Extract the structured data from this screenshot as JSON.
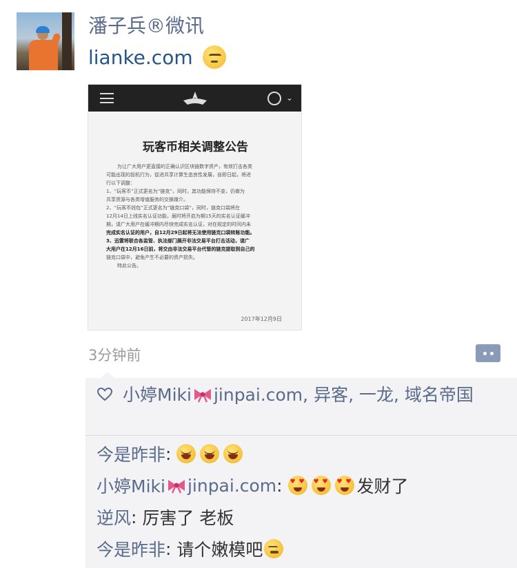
{
  "post": {
    "username": "潘子兵®微讯",
    "text": "lianke.com",
    "text_emoji": "thinking-face-icon",
    "time": "3分钟前"
  },
  "screenshot": {
    "title": "玩客币相关调整公告",
    "lines": [
      {
        "text": "为让广大用户更直接的正确认识区块链数字资产，有效打击各类",
        "bold": false,
        "indent": true
      },
      {
        "text": "可能出现的投机行为，促进共享计算生态良性发展，自即日起，将进",
        "bold": false,
        "indent": false
      },
      {
        "text": "行以下调整：",
        "bold": false,
        "indent": false
      },
      {
        "text": "1、“玩客币”正式更名为“链克”，同时，其功能保持不变，仍做为",
        "bold": false,
        "indent": false
      },
      {
        "text": "共享资源与各类增值服务的交换媒介。",
        "bold": false,
        "indent": false
      },
      {
        "text": "2、“玩客币钱包”正式更名为“链克口袋”，同时，链克口袋将在",
        "bold": false,
        "indent": false
      },
      {
        "text": "12月14日上线实名认证功能，届时将开启为期15天的实名认证缓冲",
        "bold": false,
        "indent": false
      },
      {
        "text": "期，请广大用户在缓冲期内尽快完成实名认证，对在规定的时间内未",
        "bold": false,
        "indent": false
      },
      {
        "text": "完成实名认证的用户，自12月29日起将无法使用链克口袋转账功能。",
        "bold": true,
        "indent": false
      },
      {
        "text": "3、迅雷将联合各监管、执法部门展开非法交易平台打击活动，请广",
        "bold": true,
        "indent": false
      },
      {
        "text": "大用户在12月16日前，将交由非法交易平台代管的链克提取到自己的",
        "bold": true,
        "indent": false
      },
      {
        "text": "链克口袋中，避免产生不必要的资产损失。",
        "bold": false,
        "indent": false
      },
      {
        "text": "特此公告。",
        "bold": false,
        "indent": true
      }
    ],
    "date": "2017年12月9日"
  },
  "likes": {
    "names": [
      "小婷Miki",
      "jinpai.com",
      "异客",
      "一龙",
      "域名帝国"
    ],
    "separator": ", "
  },
  "comments": [
    {
      "author": "今是昨非",
      "colon": ": ",
      "text": "",
      "emojis": [
        "laugh",
        "laugh",
        "laugh"
      ]
    },
    {
      "author_a": "小婷Miki",
      "author_b": "jinpai.com",
      "colon": ": ",
      "text": "发财了",
      "emojis": [
        "heart-eyes",
        "heart-eyes",
        "heart-eyes"
      ]
    },
    {
      "author": "逆风",
      "colon": ": ",
      "text": "厉害了 老板"
    },
    {
      "author": "今是昨非",
      "colon": ": ",
      "text": "请个嫩模吧",
      "emojis": [
        "sweat"
      ]
    }
  ],
  "colors": {
    "name_blue": "#5b6b8c",
    "link_blue": "#24548a",
    "panel_bg": "#f3f3f5"
  }
}
